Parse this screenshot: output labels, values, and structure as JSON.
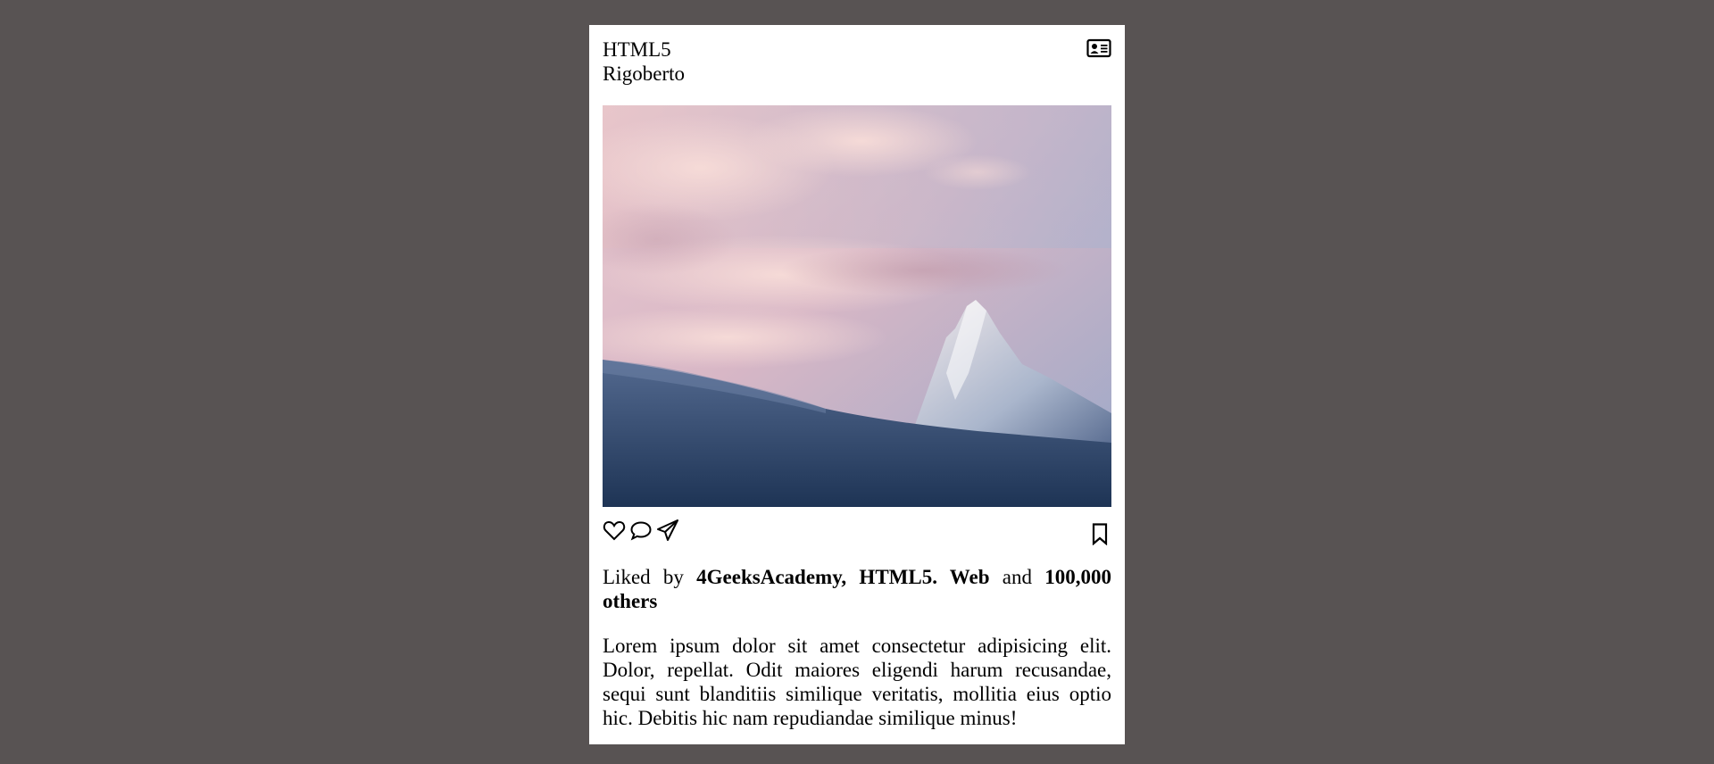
{
  "post": {
    "title": "HTML5",
    "author": "Rigoberto",
    "contact_icon": "contact-card-icon",
    "image_icon": "mountain-photo",
    "actions": {
      "like_icon": "heart-icon",
      "comment_icon": "comment-icon",
      "share_icon": "send-icon",
      "save_icon": "bookmark-icon"
    },
    "likes": {
      "prefix": "Liked by",
      "names": "4GeeksAcademy, HTML5. Web",
      "conjunction": "and",
      "count": "100,000 others"
    },
    "caption": "Lorem ipsum dolor sit amet consectetur adipisicing elit. Dolor, repellat. Odit maiores eligendi harum recusandae, sequi sunt blanditiis similique veritatis, mollitia eius optio hic. Debitis hic nam repudiandae similique minus!"
  },
  "colors": {
    "page_background": "#585353",
    "card_background": "#ffffff",
    "text": "#000000"
  }
}
